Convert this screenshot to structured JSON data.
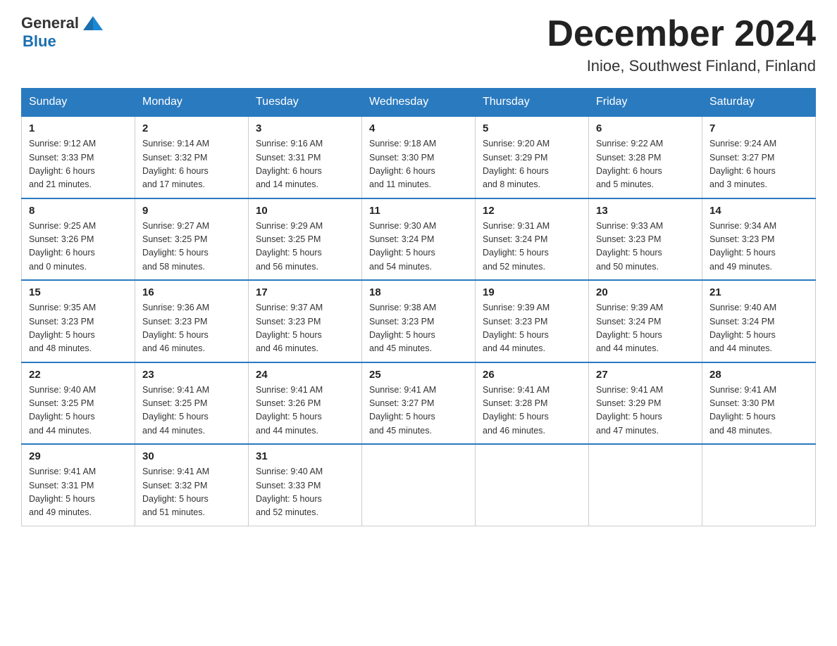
{
  "logo": {
    "general": "General",
    "blue": "Blue"
  },
  "title": "December 2024",
  "subtitle": "Inioe, Southwest Finland, Finland",
  "days_header": [
    "Sunday",
    "Monday",
    "Tuesday",
    "Wednesday",
    "Thursday",
    "Friday",
    "Saturday"
  ],
  "weeks": [
    [
      {
        "day": "1",
        "info": "Sunrise: 9:12 AM\nSunset: 3:33 PM\nDaylight: 6 hours\nand 21 minutes."
      },
      {
        "day": "2",
        "info": "Sunrise: 9:14 AM\nSunset: 3:32 PM\nDaylight: 6 hours\nand 17 minutes."
      },
      {
        "day": "3",
        "info": "Sunrise: 9:16 AM\nSunset: 3:31 PM\nDaylight: 6 hours\nand 14 minutes."
      },
      {
        "day": "4",
        "info": "Sunrise: 9:18 AM\nSunset: 3:30 PM\nDaylight: 6 hours\nand 11 minutes."
      },
      {
        "day": "5",
        "info": "Sunrise: 9:20 AM\nSunset: 3:29 PM\nDaylight: 6 hours\nand 8 minutes."
      },
      {
        "day": "6",
        "info": "Sunrise: 9:22 AM\nSunset: 3:28 PM\nDaylight: 6 hours\nand 5 minutes."
      },
      {
        "day": "7",
        "info": "Sunrise: 9:24 AM\nSunset: 3:27 PM\nDaylight: 6 hours\nand 3 minutes."
      }
    ],
    [
      {
        "day": "8",
        "info": "Sunrise: 9:25 AM\nSunset: 3:26 PM\nDaylight: 6 hours\nand 0 minutes."
      },
      {
        "day": "9",
        "info": "Sunrise: 9:27 AM\nSunset: 3:25 PM\nDaylight: 5 hours\nand 58 minutes."
      },
      {
        "day": "10",
        "info": "Sunrise: 9:29 AM\nSunset: 3:25 PM\nDaylight: 5 hours\nand 56 minutes."
      },
      {
        "day": "11",
        "info": "Sunrise: 9:30 AM\nSunset: 3:24 PM\nDaylight: 5 hours\nand 54 minutes."
      },
      {
        "day": "12",
        "info": "Sunrise: 9:31 AM\nSunset: 3:24 PM\nDaylight: 5 hours\nand 52 minutes."
      },
      {
        "day": "13",
        "info": "Sunrise: 9:33 AM\nSunset: 3:23 PM\nDaylight: 5 hours\nand 50 minutes."
      },
      {
        "day": "14",
        "info": "Sunrise: 9:34 AM\nSunset: 3:23 PM\nDaylight: 5 hours\nand 49 minutes."
      }
    ],
    [
      {
        "day": "15",
        "info": "Sunrise: 9:35 AM\nSunset: 3:23 PM\nDaylight: 5 hours\nand 48 minutes."
      },
      {
        "day": "16",
        "info": "Sunrise: 9:36 AM\nSunset: 3:23 PM\nDaylight: 5 hours\nand 46 minutes."
      },
      {
        "day": "17",
        "info": "Sunrise: 9:37 AM\nSunset: 3:23 PM\nDaylight: 5 hours\nand 46 minutes."
      },
      {
        "day": "18",
        "info": "Sunrise: 9:38 AM\nSunset: 3:23 PM\nDaylight: 5 hours\nand 45 minutes."
      },
      {
        "day": "19",
        "info": "Sunrise: 9:39 AM\nSunset: 3:23 PM\nDaylight: 5 hours\nand 44 minutes."
      },
      {
        "day": "20",
        "info": "Sunrise: 9:39 AM\nSunset: 3:24 PM\nDaylight: 5 hours\nand 44 minutes."
      },
      {
        "day": "21",
        "info": "Sunrise: 9:40 AM\nSunset: 3:24 PM\nDaylight: 5 hours\nand 44 minutes."
      }
    ],
    [
      {
        "day": "22",
        "info": "Sunrise: 9:40 AM\nSunset: 3:25 PM\nDaylight: 5 hours\nand 44 minutes."
      },
      {
        "day": "23",
        "info": "Sunrise: 9:41 AM\nSunset: 3:25 PM\nDaylight: 5 hours\nand 44 minutes."
      },
      {
        "day": "24",
        "info": "Sunrise: 9:41 AM\nSunset: 3:26 PM\nDaylight: 5 hours\nand 44 minutes."
      },
      {
        "day": "25",
        "info": "Sunrise: 9:41 AM\nSunset: 3:27 PM\nDaylight: 5 hours\nand 45 minutes."
      },
      {
        "day": "26",
        "info": "Sunrise: 9:41 AM\nSunset: 3:28 PM\nDaylight: 5 hours\nand 46 minutes."
      },
      {
        "day": "27",
        "info": "Sunrise: 9:41 AM\nSunset: 3:29 PM\nDaylight: 5 hours\nand 47 minutes."
      },
      {
        "day": "28",
        "info": "Sunrise: 9:41 AM\nSunset: 3:30 PM\nDaylight: 5 hours\nand 48 minutes."
      }
    ],
    [
      {
        "day": "29",
        "info": "Sunrise: 9:41 AM\nSunset: 3:31 PM\nDaylight: 5 hours\nand 49 minutes."
      },
      {
        "day": "30",
        "info": "Sunrise: 9:41 AM\nSunset: 3:32 PM\nDaylight: 5 hours\nand 51 minutes."
      },
      {
        "day": "31",
        "info": "Sunrise: 9:40 AM\nSunset: 3:33 PM\nDaylight: 5 hours\nand 52 minutes."
      },
      {
        "day": "",
        "info": ""
      },
      {
        "day": "",
        "info": ""
      },
      {
        "day": "",
        "info": ""
      },
      {
        "day": "",
        "info": ""
      }
    ]
  ]
}
